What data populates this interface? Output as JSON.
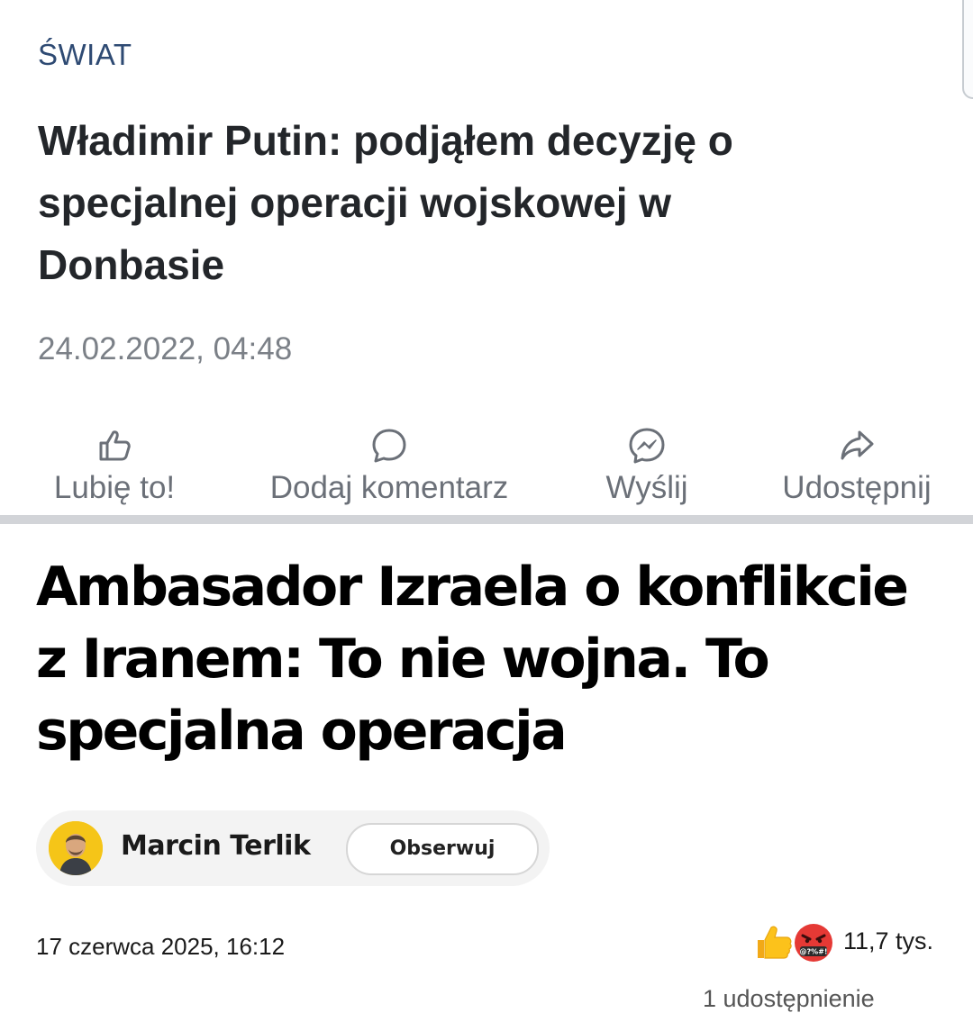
{
  "post1": {
    "section": "ŚWIAT",
    "headline": "Władimir Putin: podjąłem decyzję o specjalnej operacji wojskowej w Donbasie",
    "date": "24.02.2022, 04:48",
    "actions": [
      {
        "label": "Lubię to!",
        "icon": "thumbs-up-icon"
      },
      {
        "label": "Dodaj komentarz",
        "icon": "comment-icon"
      },
      {
        "label": "Wyślij",
        "icon": "messenger-icon"
      },
      {
        "label": "Udostępnij",
        "icon": "share-icon"
      }
    ]
  },
  "post2": {
    "headline": "Ambasador Izraela o konflikcie z Iranem: To nie wojna. To specjalna operacja",
    "author": {
      "name": "Marcin Terlik",
      "follow_label": "Obserwuj"
    },
    "date": "17 czerwca 2025, 16:12",
    "reactions": {
      "icons": [
        "thumbs-up-emoji",
        "angry-swearing-emoji"
      ],
      "count": "11,7 tys."
    },
    "shares": "1 udostępnienie"
  },
  "colors": {
    "section": "#2e4a73",
    "headline1": "#23262a",
    "muted": "#7b8087",
    "divider": "#d2d4d8",
    "chip": "#f3f3f3",
    "avatar": "#f5c518"
  }
}
